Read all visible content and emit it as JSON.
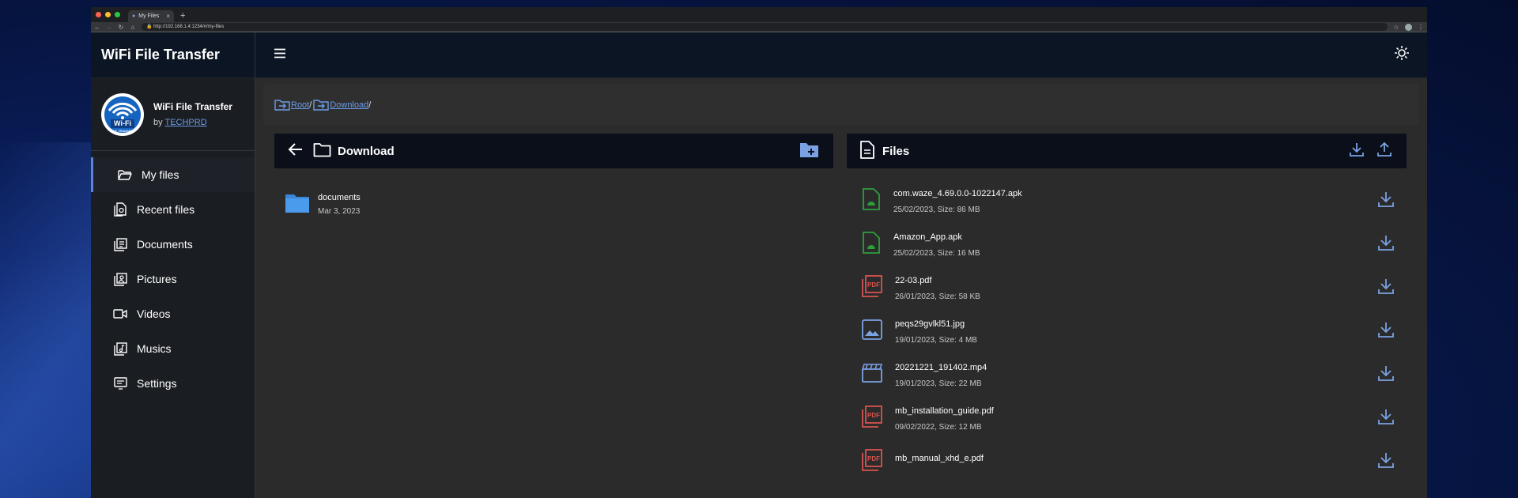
{
  "browser": {
    "tab_title": "My Files",
    "url": "http://192.168.1.4:1234/#/my-files"
  },
  "app": {
    "brand": "WiFi File Transfer",
    "profile_name": "WiFi File Transfer",
    "by_label": "by",
    "author": "TECHPRD",
    "logo_text": "Wi-Fi",
    "logo_sub": "FILE TRANSFER"
  },
  "nav": [
    {
      "label": "My files",
      "icon": "folder-open-icon",
      "active": true
    },
    {
      "label": "Recent files",
      "icon": "recent-file-icon"
    },
    {
      "label": "Documents",
      "icon": "documents-icon"
    },
    {
      "label": "Pictures",
      "icon": "pictures-icon"
    },
    {
      "label": "Videos",
      "icon": "video-camera-icon"
    },
    {
      "label": "Musics",
      "icon": "music-library-icon"
    },
    {
      "label": "Settings",
      "icon": "settings-icon"
    }
  ],
  "breadcrumb": [
    {
      "label": "Root"
    },
    {
      "label": "Download"
    }
  ],
  "folders_panel": {
    "title": "Download",
    "items": [
      {
        "name": "documents",
        "date": "Mar 3, 2023"
      }
    ]
  },
  "files_panel": {
    "title": "Files",
    "items": [
      {
        "name": "com.waze_4.69.0.0-1022147.apk",
        "meta": "25/02/2023, Size: 86 MB",
        "type": "apk"
      },
      {
        "name": "Amazon_App.apk",
        "meta": "25/02/2023, Size: 16 MB",
        "type": "apk"
      },
      {
        "name": "22-03.pdf",
        "meta": "26/01/2023, Size: 58 KB",
        "type": "pdf"
      },
      {
        "name": "peqs29gvlkl51.jpg",
        "meta": "19/01/2023, Size: 4 MB",
        "type": "image"
      },
      {
        "name": "20221221_191402.mp4",
        "meta": "19/01/2023, Size: 22 MB",
        "type": "video"
      },
      {
        "name": "mb_installation_guide.pdf",
        "meta": "09/02/2022, Size: 12 MB",
        "type": "pdf"
      },
      {
        "name": "mb_manual_xhd_e.pdf",
        "meta": "",
        "type": "pdf"
      }
    ]
  },
  "colors": {
    "accent": "#5e83d6",
    "apk": "#2e9e3c",
    "pdf": "#d9534f",
    "image": "#7aa2e3",
    "video": "#7aa2e3"
  }
}
